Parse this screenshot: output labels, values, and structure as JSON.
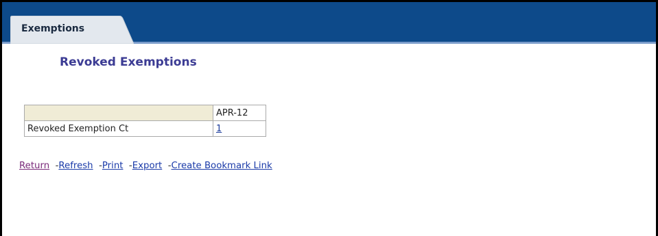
{
  "tab": {
    "label": "Exemptions"
  },
  "report": {
    "title": "Revoked Exemptions"
  },
  "table": {
    "column_header": "APR-12",
    "row_header": "Revoked Exemption Ct",
    "value": "1"
  },
  "links": [
    {
      "label": "Return"
    },
    {
      "label": "Refresh"
    },
    {
      "label": "Print"
    },
    {
      "label": "Export"
    },
    {
      "label": "Create Bookmark Link"
    }
  ],
  "colors": {
    "tabbar": "#0d4a8a",
    "tab": "#e3e8ee",
    "title": "#3c3c94",
    "corner_cell": "#f0ecd6",
    "link": "#1a3aa8",
    "visited_link": "#7a2a7a"
  }
}
